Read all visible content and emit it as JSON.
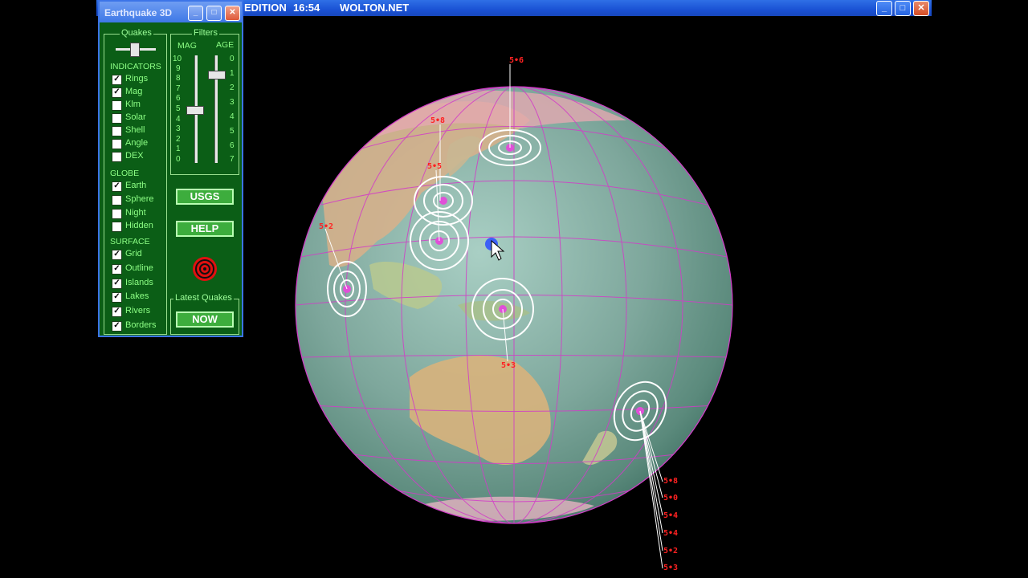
{
  "main_window": {
    "title_left": "EDITION",
    "time": "16:54",
    "site": "WOLTON.NET",
    "minimize_icon": "_",
    "maximize_icon": "□",
    "close_icon": "✕"
  },
  "panel": {
    "title": "Earthquake 3D",
    "minimize_icon": "_",
    "maximize_icon": "□",
    "close_icon": "✕",
    "quakes_group": "Quakes",
    "filters_group": "Filters",
    "indicators_header": "INDICATORS",
    "indicators": [
      {
        "label": "Rings",
        "checked": true
      },
      {
        "label": "Mag",
        "checked": true
      },
      {
        "label": "Klm",
        "checked": false
      },
      {
        "label": "Solar",
        "checked": false
      },
      {
        "label": "Shell",
        "checked": false
      },
      {
        "label": "Angle",
        "checked": false
      },
      {
        "label": "DEX",
        "checked": false
      }
    ],
    "globe_header": "GLOBE",
    "globe": [
      {
        "label": "Earth",
        "checked": true
      },
      {
        "label": "Sphere",
        "checked": false
      },
      {
        "label": "Night",
        "checked": false
      },
      {
        "label": "Hidden",
        "checked": false
      }
    ],
    "surface_header": "SURFACE",
    "surface": [
      {
        "label": "Grid",
        "checked": true
      },
      {
        "label": "Outline",
        "checked": true
      },
      {
        "label": "Islands",
        "checked": true
      },
      {
        "label": "Lakes",
        "checked": true
      },
      {
        "label": "Rivers",
        "checked": true
      },
      {
        "label": "Borders",
        "checked": true
      }
    ],
    "mag_label": "MAG",
    "age_label": "AGE",
    "mag_scale": [
      "10",
      "9",
      "8",
      "7",
      "6",
      "5",
      "4",
      "3",
      "2",
      "1",
      "0"
    ],
    "age_scale": [
      "0",
      "1",
      "2",
      "3",
      "4",
      "5",
      "6",
      "7"
    ],
    "mag_value": 5,
    "age_value": 1,
    "usgs_button": "USGS",
    "help_button": "HELP",
    "target_icon": "target-icon",
    "latest_group": "Latest Quakes",
    "now_button": "NOW",
    "check_mark": "✓"
  },
  "quakes": [
    {
      "mag": "5•6"
    },
    {
      "mag": "5•8"
    },
    {
      "mag": "5•5"
    },
    {
      "mag": "5•2"
    },
    {
      "mag": "5•3"
    },
    {
      "mag": "5•8"
    },
    {
      "mag": "5•0"
    },
    {
      "mag": "5•4"
    },
    {
      "mag": "5•4"
    },
    {
      "mag": "5•2"
    },
    {
      "mag": "5•3"
    }
  ],
  "colors": {
    "panel_bg": "#0b5e16",
    "panel_text": "#8dff85",
    "button_bg": "#3dad3d",
    "titlebar": "#1a52d4",
    "quake_label": "#ff2222",
    "grid_lines": "#d23cc8",
    "ocean": "#7fa9a0"
  }
}
